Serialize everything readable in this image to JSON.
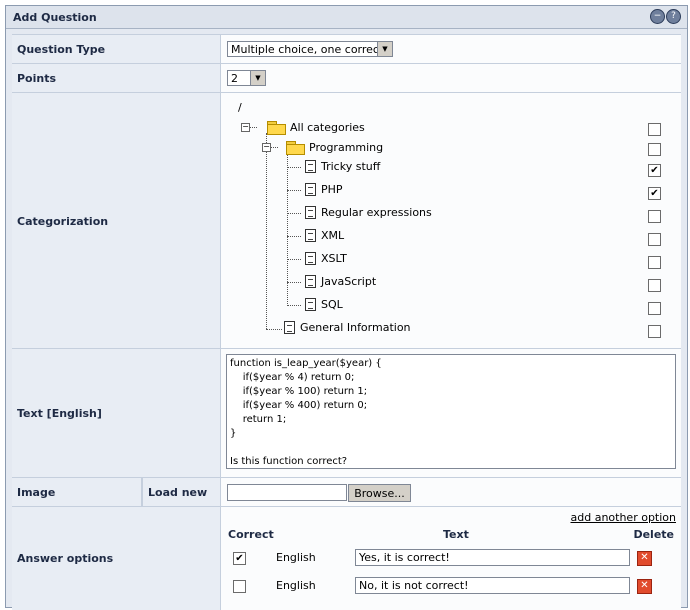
{
  "window": {
    "title": "Add Question"
  },
  "question_type": {
    "label": "Question Type",
    "value": "Multiple choice, one correct"
  },
  "points": {
    "label": "Points",
    "value": "2"
  },
  "categorization": {
    "label": "Categorization",
    "root": "/",
    "items": [
      {
        "label": "All categories",
        "icon": "folder-icon",
        "checked": false
      },
      {
        "label": "Programming",
        "icon": "folder-icon",
        "checked": false
      },
      {
        "label": "Tricky stuff",
        "icon": "document-icon",
        "checked": true
      },
      {
        "label": "PHP",
        "icon": "document-icon",
        "checked": true
      },
      {
        "label": "Regular expressions",
        "icon": "document-icon",
        "checked": false
      },
      {
        "label": "XML",
        "icon": "document-icon",
        "checked": false
      },
      {
        "label": "XSLT",
        "icon": "document-icon",
        "checked": false
      },
      {
        "label": "JavaScript",
        "icon": "document-icon",
        "checked": false
      },
      {
        "label": "SQL",
        "icon": "document-icon",
        "checked": false
      },
      {
        "label": "General Information",
        "icon": "document-icon",
        "checked": false
      }
    ]
  },
  "text": {
    "label": "Text [English]",
    "value": "function is_leap_year($year) {\n    if($year % 4) return 0;\n    if($year % 100) return 1;\n    if($year % 400) return 0;\n    return 1;\n}\n\nIs this function correct?"
  },
  "image": {
    "label": "Image",
    "sublabel": "Load new",
    "browse": "Browse..."
  },
  "answers": {
    "label": "Answer options",
    "add_link": "add another option",
    "col_correct": "Correct",
    "col_text": "Text",
    "col_delete": "Delete",
    "rows": [
      {
        "correct": true,
        "lang": "English",
        "text": "Yes, it is correct!"
      },
      {
        "correct": false,
        "lang": "English",
        "text": "No, it is not correct!"
      }
    ]
  }
}
